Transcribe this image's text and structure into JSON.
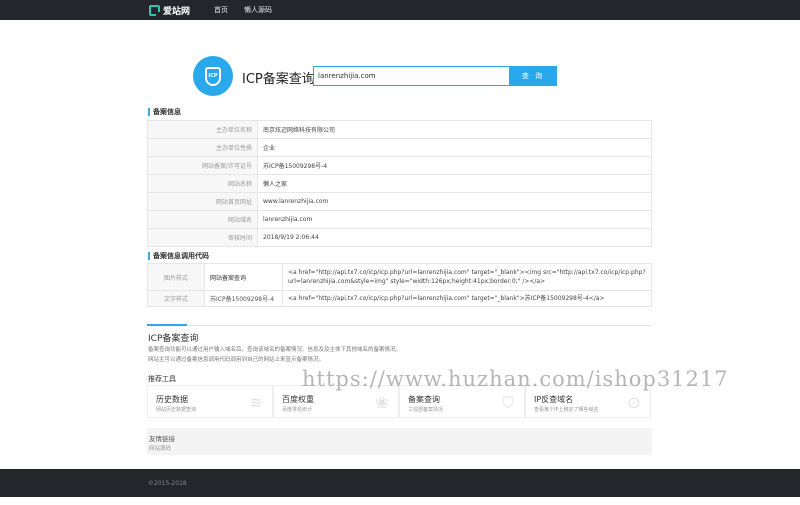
{
  "header": {
    "logo_text": "爱站网",
    "nav": [
      "首页",
      "懒人源码"
    ]
  },
  "search": {
    "title": "ICP备案查询",
    "value": "lanrenzhijia.com",
    "button": "查 询",
    "icon_text": "ICP"
  },
  "record_info": {
    "title": "备案信息",
    "rows": [
      {
        "label": "主办单位名称",
        "value": "南京炫迈网络科技有限公司"
      },
      {
        "label": "主办单位性质",
        "value": "企业"
      },
      {
        "label": "网站备案/许可证号",
        "value": "苏ICP备15009298号-4"
      },
      {
        "label": "网站名称",
        "value": "懒人之家"
      },
      {
        "label": "网站首页网址",
        "value": "www.lanrenzhijia.com"
      },
      {
        "label": "网站域名",
        "value": "lanrenzhijia.com"
      },
      {
        "label": "审核时间",
        "value": "2018/9/19 2:06:44"
      }
    ]
  },
  "embed_code": {
    "title": "备案信息调用代码",
    "rows": [
      {
        "style": "图片样式",
        "name": "网站备案查询",
        "code": "<a href=\"http://api.tx7.co/icp/icp.php?url=lanrenzhijia.com\" target=\"_blank\"><img src=\"http://api.tx7.co/icp/icp.php?url=lanrenzhijia.com&style=img\" style=\"width:126px;height:41px;border:0;\" /></a>"
      },
      {
        "style": "文字样式",
        "name": "苏ICP备15009298号-4",
        "code": "<a href=\"http://api.tx7.co/icp/icp.php?url=lanrenzhijia.com\" target=\"_blank\">苏ICP备15009298号-4</a>"
      }
    ]
  },
  "about": {
    "title": "ICP备案查询",
    "lines": [
      "备案查询功能可以通过用户输入域名后，查询该域名的备案情况、信息及及主体下其他域名的备案情况。",
      "网站主可以通过备案信息调用代码调用到自己的网站上来显示备案情况。"
    ]
  },
  "tools": {
    "title": "推荐工具",
    "items": [
      {
        "name": "历史数据",
        "desc": "网站历史数据查询",
        "icon": "layers-icon",
        "glyph": "≋"
      },
      {
        "name": "百度权重",
        "desc": "百度排名统计",
        "icon": "paw-icon",
        "glyph": "❀"
      },
      {
        "name": "备案查询",
        "desc": "工信部备案情况",
        "icon": "shield-icon",
        "glyph": "⛉"
      },
      {
        "name": "IP反查域名",
        "desc": "查看某个IP上绑定了哪些域名",
        "icon": "ip-icon",
        "glyph": "⊙"
      }
    ]
  },
  "links": {
    "title": "友情链接",
    "items": [
      "网站源码"
    ]
  },
  "footer": {
    "copyright": "©2015-2018"
  },
  "watermark": "https://www.huzhan.com/ishop31217",
  "colors": {
    "accent": "#2aa8ec",
    "dark_bar": "#23272b"
  }
}
